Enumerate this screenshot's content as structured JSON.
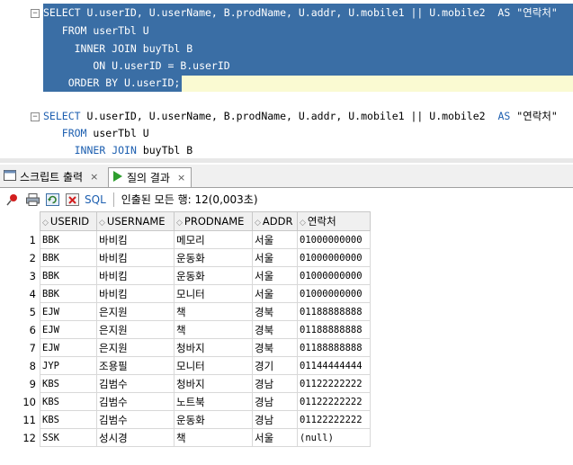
{
  "editor": {
    "lines": [
      {
        "text": "SELECT U.userID, U.userName, B.prodName, U.addr, U.mobile1 || U.mobile2  AS \"연락처\""
      },
      {
        "text": "   FROM userTbl U"
      },
      {
        "text": "     INNER JOIN buyTbl B"
      },
      {
        "text": "        ON U.userID = B.userID"
      },
      {
        "text": "    ORDER BY U.userID;"
      },
      {
        "text": ""
      },
      {
        "text": "SELECT U.userID, U.userName, B.prodName, U.addr, U.mobile1 || U.mobile2  AS \"연락처\""
      },
      {
        "text": "   FROM userTbl U"
      },
      {
        "text": "     INNER JOIN buyTbl B"
      }
    ]
  },
  "tabs": [
    {
      "label": "스크립트 출력"
    },
    {
      "label": "질의 결과"
    }
  ],
  "toolbar": {
    "sql_label": "SQL",
    "status": "인출된 모든 행: 12(0,003초)"
  },
  "grid": {
    "columns": [
      "USERID",
      "USERNAME",
      "PRODNAME",
      "ADDR",
      "연락처"
    ],
    "rows": [
      {
        "n": "1",
        "c": [
          "BBK",
          "바비킴",
          "메모리",
          "서울",
          "01000000000"
        ]
      },
      {
        "n": "2",
        "c": [
          "BBK",
          "바비킴",
          "운동화",
          "서울",
          "01000000000"
        ]
      },
      {
        "n": "3",
        "c": [
          "BBK",
          "바비킴",
          "운동화",
          "서울",
          "01000000000"
        ]
      },
      {
        "n": "4",
        "c": [
          "BBK",
          "바비킴",
          "모니터",
          "서울",
          "01000000000"
        ]
      },
      {
        "n": "5",
        "c": [
          "EJW",
          "은지원",
          "책",
          "경북",
          "01188888888"
        ]
      },
      {
        "n": "6",
        "c": [
          "EJW",
          "은지원",
          "책",
          "경북",
          "01188888888"
        ]
      },
      {
        "n": "7",
        "c": [
          "EJW",
          "은지원",
          "청바지",
          "경북",
          "01188888888"
        ]
      },
      {
        "n": "8",
        "c": [
          "JYP",
          "조용필",
          "모니터",
          "경기",
          "01144444444"
        ]
      },
      {
        "n": "9",
        "c": [
          "KBS",
          "김범수",
          "청바지",
          "경남",
          "01122222222"
        ]
      },
      {
        "n": "10",
        "c": [
          "KBS",
          "김범수",
          "노트북",
          "경남",
          "01122222222"
        ]
      },
      {
        "n": "11",
        "c": [
          "KBS",
          "김범수",
          "운동화",
          "경남",
          "01122222222"
        ]
      },
      {
        "n": "12",
        "c": [
          "SSK",
          "성시경",
          "책",
          "서울",
          "(null)"
        ]
      }
    ]
  },
  "colors": {
    "selection": "#3a6ea5",
    "keyword": "#1d5fb0"
  }
}
